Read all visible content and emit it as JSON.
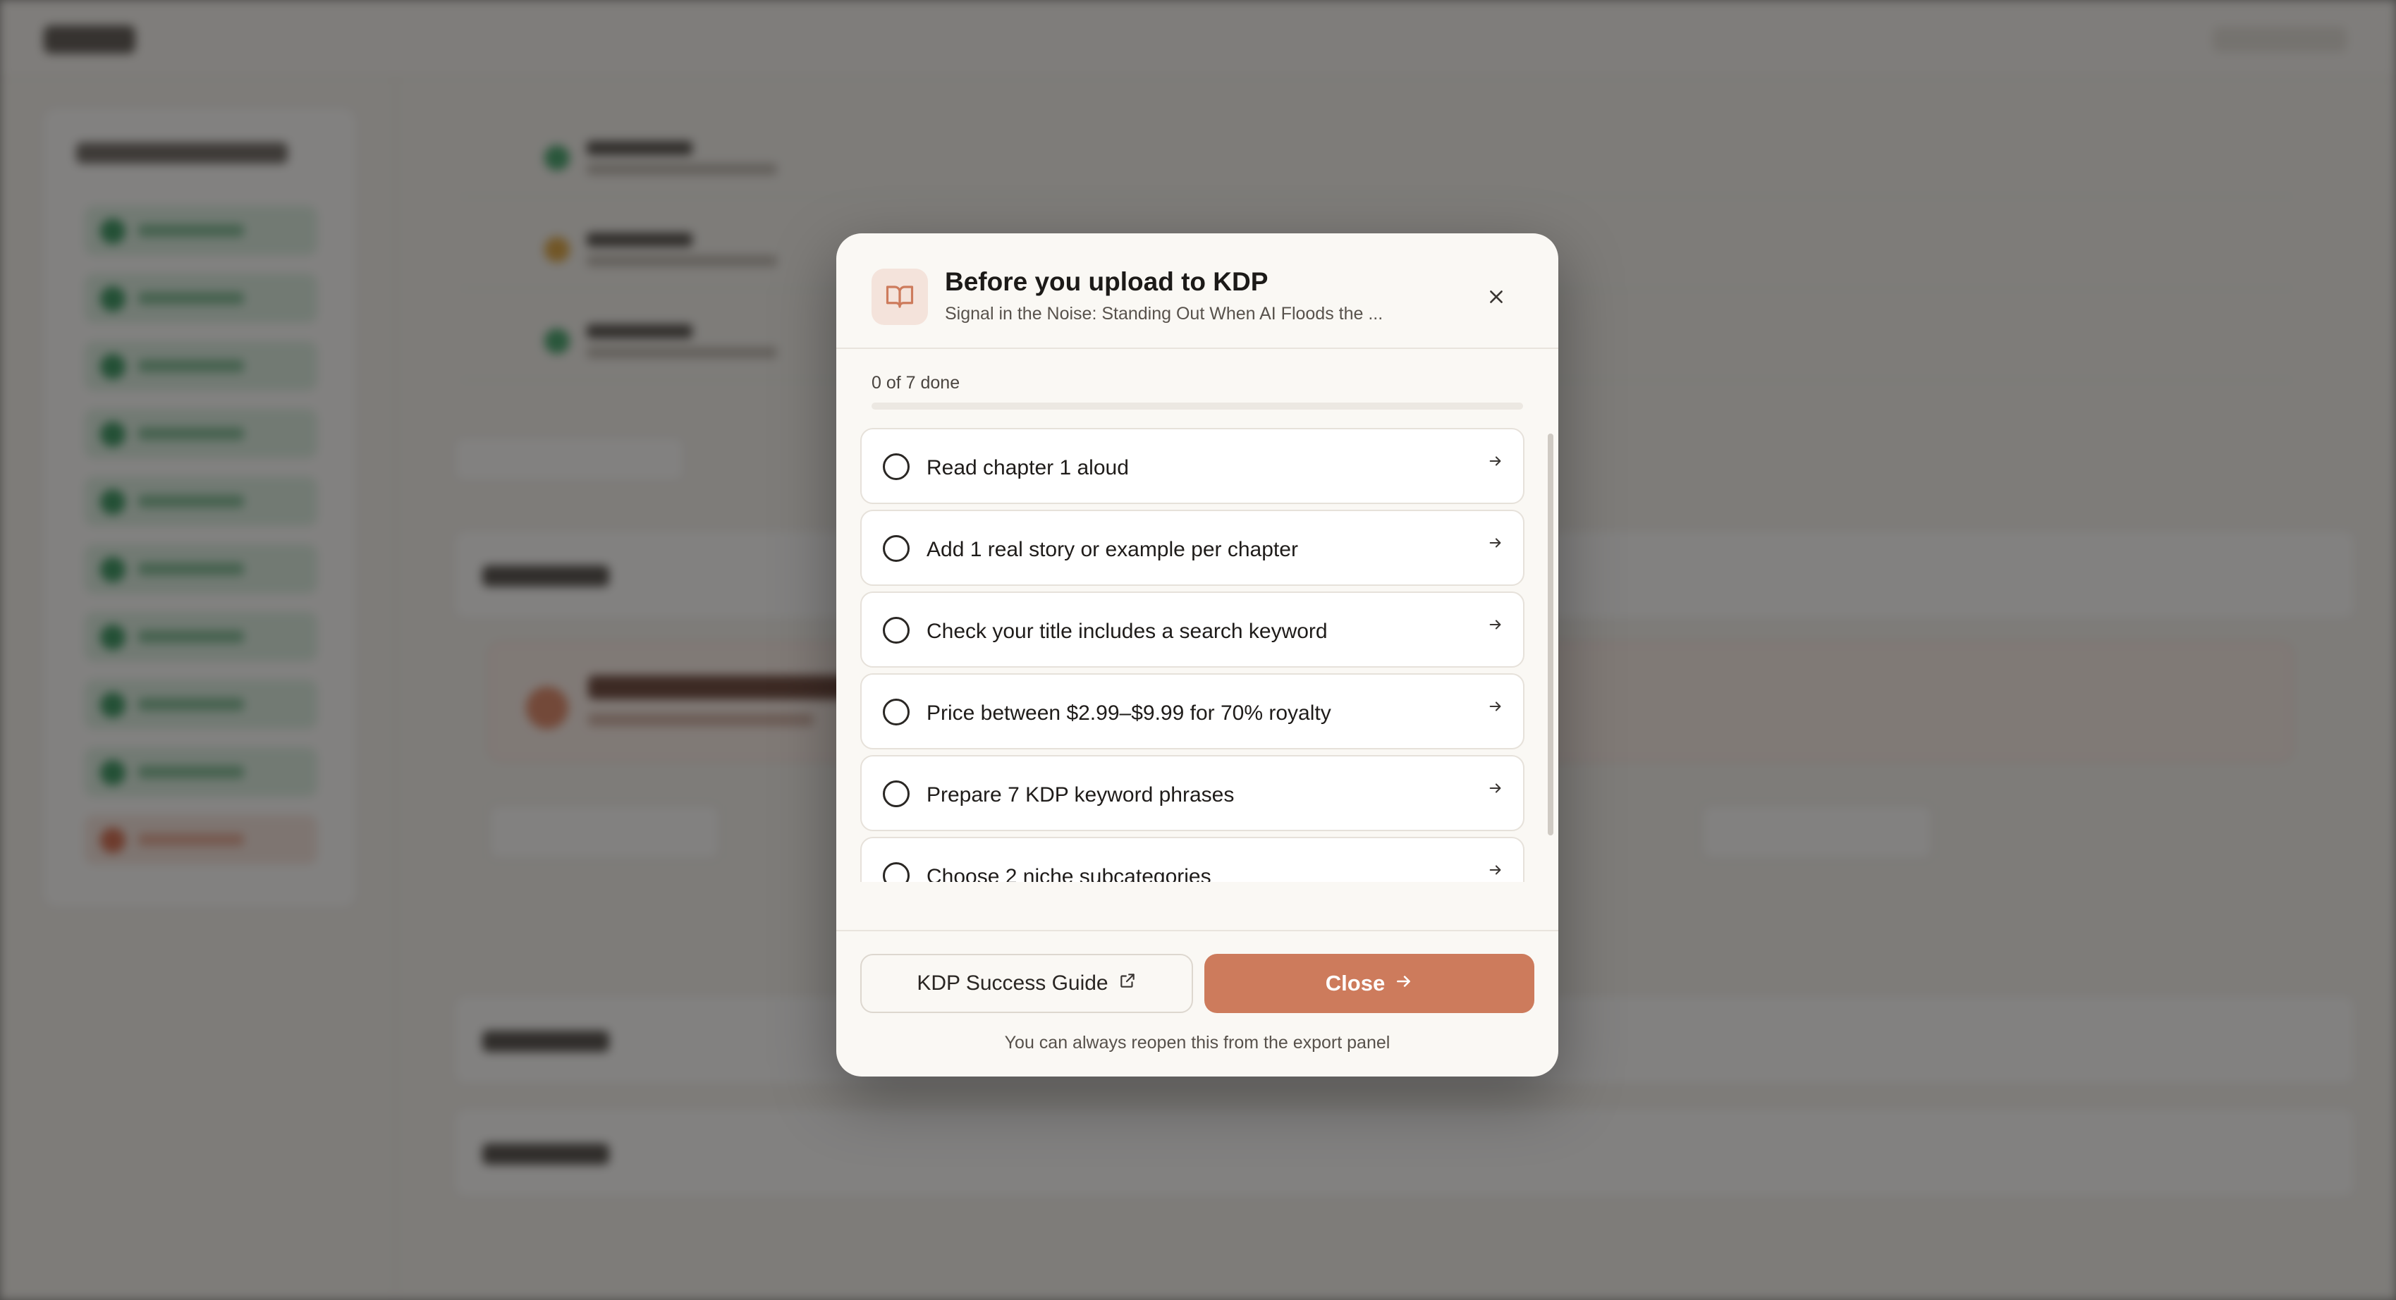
{
  "modal": {
    "title": "Before you upload to KDP",
    "subtitle": "Signal in the Noise: Standing Out When AI Floods the ...",
    "progress_text": "0 of 7 done",
    "progress_fraction": 0,
    "icons": {
      "badge": "book-open-icon",
      "close": "close-icon",
      "item_arrow": "arrow-right-icon",
      "external": "external-link-icon"
    },
    "items": [
      {
        "label": "Read chapter 1 aloud",
        "checked": false
      },
      {
        "label": "Add 1 real story or example per chapter",
        "checked": false
      },
      {
        "label": "Check your title includes a search keyword",
        "checked": false
      },
      {
        "label": "Price between $2.99–$9.99 for 70% royalty",
        "checked": false
      },
      {
        "label": "Prepare 7 KDP keyword phrases",
        "checked": false
      },
      {
        "label": "Choose 2 niche subcategories",
        "checked": false
      }
    ],
    "footer": {
      "guide_label": "KDP Success Guide",
      "close_label": "Close",
      "note": "You can always reopen this from the export panel"
    }
  },
  "colors": {
    "accent": "#cd7b5c",
    "badge_bg": "#f4e3db",
    "modal_bg": "#faf8f4",
    "overlay": "#3c3a38"
  }
}
